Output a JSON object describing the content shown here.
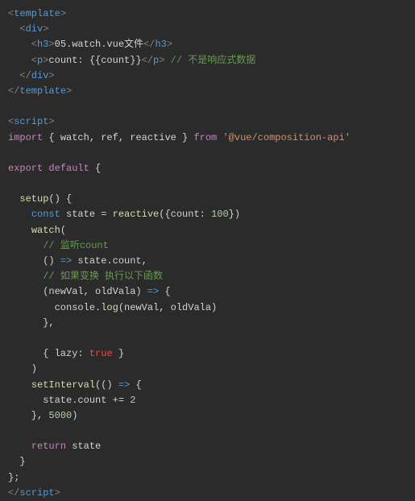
{
  "code": {
    "l1": {
      "a": "<",
      "b": "template",
      "c": ">"
    },
    "l2": {
      "a": "  <",
      "b": "div",
      "c": ">"
    },
    "l3": {
      "a": "    <",
      "b": "h3",
      "c": ">",
      "d": "05.watch.vue文件",
      "e": "</",
      "f": "h3",
      "g": ">"
    },
    "l4": {
      "a": "    <",
      "b": "p",
      "c": ">",
      "d": "count: {{count}}",
      "e": "</",
      "f": "p",
      "g": ">",
      "h": " // 不是响应式数据"
    },
    "l5": {
      "a": "  </",
      "b": "div",
      "c": ">"
    },
    "l6": {
      "a": "</",
      "b": "template",
      "c": ">"
    },
    "l7": "",
    "l8": {
      "a": "<",
      "b": "script",
      "c": ">"
    },
    "l9": {
      "a": "import",
      "b": " { watch, ref, reactive } ",
      "c": "from",
      "d": " ",
      "e": "'@vue/composition-api'"
    },
    "l10": "",
    "l11": {
      "a": "export",
      "b": " ",
      "c": "default",
      "d": " {"
    },
    "l12": "",
    "l13": {
      "a": "  ",
      "b": "setup",
      "c": "() {"
    },
    "l14": {
      "a": "    ",
      "b": "const",
      "c": " state = ",
      "d": "reactive",
      "e": "({count: ",
      "f": "100",
      "g": "})"
    },
    "l15": {
      "a": "    ",
      "b": "watch",
      "c": "("
    },
    "l16": {
      "a": "      ",
      "b": "// 监听count"
    },
    "l17": {
      "a": "      () ",
      "b": "=>",
      "c": " state.count,"
    },
    "l18": {
      "a": "      ",
      "b": "// 如果变换 执行以下函数"
    },
    "l19": {
      "a": "      (newVal, oldVala) ",
      "b": "=>",
      "c": " {"
    },
    "l20": {
      "a": "        console.",
      "b": "log",
      "c": "(newVal, oldVala)"
    },
    "l21": "      },",
    "l22": "",
    "l23": {
      "a": "      { lazy: ",
      "b": "true",
      "c": " }"
    },
    "l24": "    )",
    "l25": {
      "a": "    ",
      "b": "setInterval",
      "c": "(() ",
      "d": "=>",
      "e": " {"
    },
    "l26": {
      "a": "      state.count += ",
      "b": "2"
    },
    "l27": {
      "a": "    }, ",
      "b": "5000",
      "c": ")"
    },
    "l28": "",
    "l29": {
      "a": "    ",
      "b": "return",
      "c": " state"
    },
    "l30": "  }",
    "l31": "};",
    "l32": {
      "a": "</",
      "b": "script",
      "c": ">"
    }
  }
}
